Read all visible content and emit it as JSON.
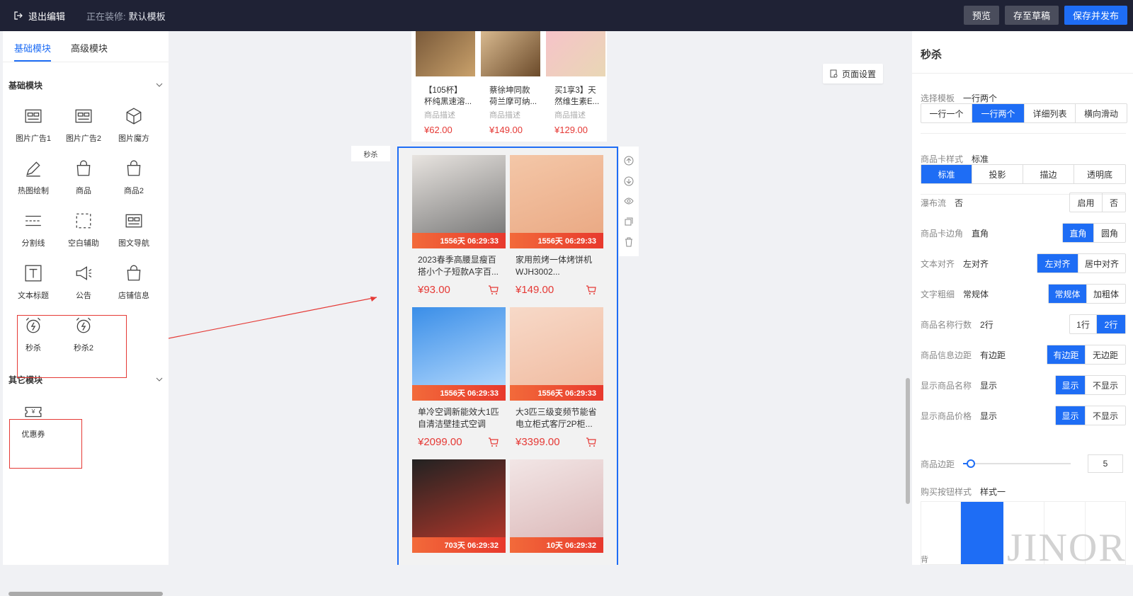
{
  "topbar": {
    "exit_label": "退出编辑",
    "editing_prefix": "正在装修:",
    "template_name": "默认模板",
    "preview": "预览",
    "save_draft": "存至草稿",
    "save_publish": "保存并发布"
  },
  "left": {
    "tabs": [
      "基础模块",
      "高级模块"
    ],
    "basic_header": "基础模块",
    "other_header": "其它模块",
    "modules": [
      {
        "label": "图片广告1",
        "icon": "image-ad-icon"
      },
      {
        "label": "图片广告2",
        "icon": "image-ad-icon"
      },
      {
        "label": "图片魔方",
        "icon": "cube-icon"
      },
      {
        "label": "热图绘制",
        "icon": "pen-icon"
      },
      {
        "label": "商品",
        "icon": "bag-icon"
      },
      {
        "label": "商品2",
        "icon": "bag-icon"
      },
      {
        "label": "分割线",
        "icon": "divider-icon"
      },
      {
        "label": "空白辅助",
        "icon": "dashed-box-icon"
      },
      {
        "label": "图文导航",
        "icon": "image-nav-icon"
      },
      {
        "label": "文本标题",
        "icon": "text-icon"
      },
      {
        "label": "公告",
        "icon": "megaphone-icon"
      },
      {
        "label": "店铺信息",
        "icon": "store-icon"
      },
      {
        "label": "秒杀",
        "icon": "alarm-icon"
      },
      {
        "label": "秒杀2",
        "icon": "alarm-icon"
      }
    ],
    "other_modules": [
      {
        "label": "优惠券",
        "icon": "coupon-icon"
      }
    ]
  },
  "canvas": {
    "page_settings": "页面设置",
    "section_label": "秒杀",
    "top_products": [
      {
        "name1": "【105杯】",
        "name2": "杯纯黑速溶...",
        "desc": "商品描述",
        "price": "¥62.00"
      },
      {
        "name1": "蔡徐坤同款",
        "name2": "荷兰摩可纳...",
        "desc": "商品描述",
        "price": "¥149.00"
      },
      {
        "name1": "买1享3】天",
        "name2": "然维生素E...",
        "desc": "商品描述",
        "price": "¥129.00"
      }
    ],
    "flash_products": [
      {
        "name": "2023春季高腰显瘦百搭小个子短款A字百...",
        "price": "¥93.00",
        "timer": "1556天 06:29:33"
      },
      {
        "name": "家用煎烤一体烤饼机WJH3002...",
        "price": "¥149.00",
        "timer": "1556天 06:29:33"
      },
      {
        "name": "单冷空调新能效大1匹自清洁壁挂式空调",
        "price": "¥2099.00",
        "timer": "1556天 06:29:33"
      },
      {
        "name": "大3匹三级变频节能省电立柜式客厅2P柜...",
        "price": "¥3399.00",
        "timer": "1556天 06:29:33"
      },
      {
        "name": "",
        "price": "",
        "timer": "703天 06:29:32"
      },
      {
        "name": "",
        "price": "",
        "timer": "10天 06:29:32"
      }
    ]
  },
  "right": {
    "title": "秒杀",
    "template": {
      "label": "选择模板",
      "value": "一行两个",
      "options": [
        "一行一个",
        "一行两个",
        "详细列表",
        "横向滑动"
      ],
      "selected": 1
    },
    "card_style": {
      "label": "商品卡样式",
      "value": "标准",
      "options": [
        "标准",
        "投影",
        "描边",
        "透明底"
      ],
      "selected": 0
    },
    "waterfall": {
      "label": "瀑布流",
      "value": "否",
      "options": [
        "启用",
        "否"
      ],
      "selected": -1
    },
    "corner": {
      "label": "商品卡边角",
      "value": "直角",
      "options": [
        "直角",
        "圆角"
      ],
      "selected": 0
    },
    "align": {
      "label": "文本对齐",
      "value": "左对齐",
      "options": [
        "左对齐",
        "居中对齐"
      ],
      "selected": 0
    },
    "weight": {
      "label": "文字粗细",
      "value": "常规体",
      "options": [
        "常规体",
        "加粗体"
      ],
      "selected": 0
    },
    "name_lines": {
      "label": "商品名称行数",
      "value": "2行",
      "options": [
        "1行",
        "2行"
      ],
      "selected": 1
    },
    "info_margin": {
      "label": "商品信息边距",
      "value": "有边距",
      "options": [
        "有边距",
        "无边距"
      ],
      "selected": 0
    },
    "show_name": {
      "label": "显示商品名称",
      "value": "显示",
      "options": [
        "显示",
        "不显示"
      ],
      "selected": 0
    },
    "show_price": {
      "label": "显示商品价格",
      "value": "显示",
      "options": [
        "显示",
        "不显示"
      ],
      "selected": 0
    },
    "margin": {
      "label": "商品边距",
      "value": "5",
      "slider_fraction": 0.07
    },
    "buy_btn": {
      "label": "购买按钮样式",
      "value": "样式一"
    },
    "bottom_label": "背"
  },
  "watermark": "JINOR",
  "colors": {
    "primary": "#1e6df5",
    "price": "#e53935",
    "topbar": "#1f2235"
  }
}
